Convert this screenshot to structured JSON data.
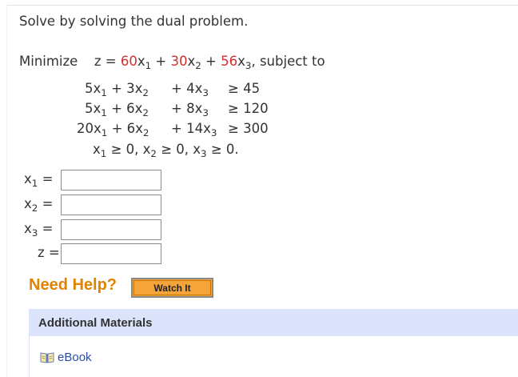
{
  "instructions": "Solve by solving the dual problem.",
  "objective": {
    "prefix": "Minimize",
    "lhs": "z = ",
    "coef1": "60",
    "var1": "x",
    "sub1": "1",
    "plus1": " + ",
    "coef2": "30",
    "var2": "x",
    "sub2": "2",
    "plus2": " + ",
    "coef3": "56",
    "var3": "x",
    "sub3": "3",
    "suffix": ",  subject to"
  },
  "constraints": [
    {
      "t1": "5x",
      "s1": "1",
      "t2": " + 3x",
      "s2": "2",
      "t3": "+ 4x",
      "s3": "3",
      "rhs": "≥ 45"
    },
    {
      "t1": "5x",
      "s1": "1",
      "t2": " + 6x",
      "s2": "2",
      "t3": "+ 8x",
      "s3": "3",
      "rhs": "≥ 120"
    },
    {
      "t1": "20x",
      "s1": "1",
      "t2": " + 6x",
      "s2": "2",
      "t3": "+ 14x",
      "s3": "3",
      "rhs": "≥ 300"
    }
  ],
  "nonneg": {
    "a": "x",
    "sa": "1",
    "b": " ≥ 0, x",
    "sb": "2",
    "c": " ≥ 0, x",
    "sc": "3",
    "d": " ≥ 0."
  },
  "answers": [
    {
      "var": "x",
      "sub": "1",
      "eq": " =",
      "value": ""
    },
    {
      "var": "x",
      "sub": "2",
      "eq": " =",
      "value": ""
    },
    {
      "var": "x",
      "sub": "3",
      "eq": " =",
      "value": ""
    },
    {
      "var": "z",
      "sub": "",
      "eq": " =",
      "value": ""
    }
  ],
  "help": {
    "title": "Need Help?",
    "watch_label": "Watch It"
  },
  "additional": {
    "title": "Additional Materials",
    "ebook_label": "eBook"
  },
  "colors": {
    "coefficient": "#d32f2f",
    "help": "#e08300",
    "button": "#f5a43a",
    "panel": "#dbe4fb",
    "link": "#2b4fa8"
  },
  "icons": {
    "ebook": "book-icon"
  }
}
